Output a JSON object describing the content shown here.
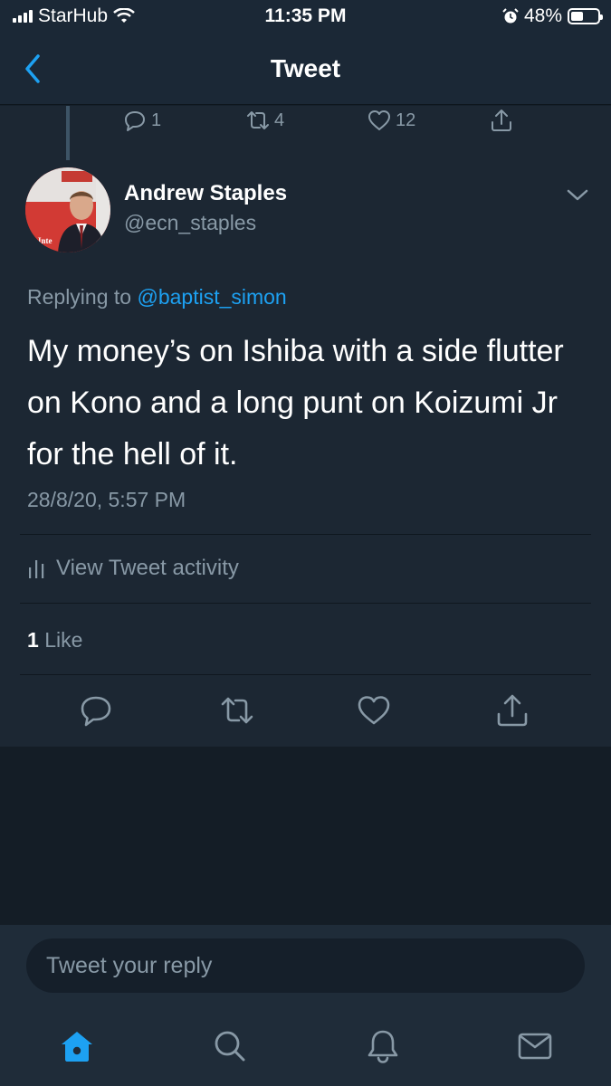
{
  "status_bar": {
    "carrier": "StarHub",
    "time": "11:35 PM",
    "battery_percent": "48%",
    "battery_level": 0.48,
    "icons": [
      "signal-icon",
      "wifi-icon",
      "alarm-icon",
      "battery-icon"
    ]
  },
  "nav": {
    "title": "Tweet",
    "back_icon": "chevron-left-icon"
  },
  "previous_tweet_actions": {
    "replies": "1",
    "retweets": "4",
    "likes": "12"
  },
  "tweet": {
    "author_name": "Andrew Staples",
    "author_handle": "@ecn_staples",
    "replying_prefix": "Replying to",
    "replying_to": "@baptist_simon",
    "text": "My money’s on Ishiba with a side flutter on Kono and a long punt on Koizumi Jr for the hell of it.",
    "timestamp": "28/8/20, 5:57 PM",
    "view_activity_label": "View Tweet activity",
    "likes_count": "1",
    "likes_label": "Like"
  },
  "reply": {
    "placeholder": "Tweet your reply"
  },
  "tab_bar": {
    "items": [
      "home-icon",
      "search-icon",
      "notifications-icon",
      "messages-icon"
    ],
    "active": "home-icon"
  },
  "colors": {
    "background": "#15202b",
    "card": "#1c2733",
    "accent": "#1da1f2",
    "secondary_text": "#8899a6"
  }
}
